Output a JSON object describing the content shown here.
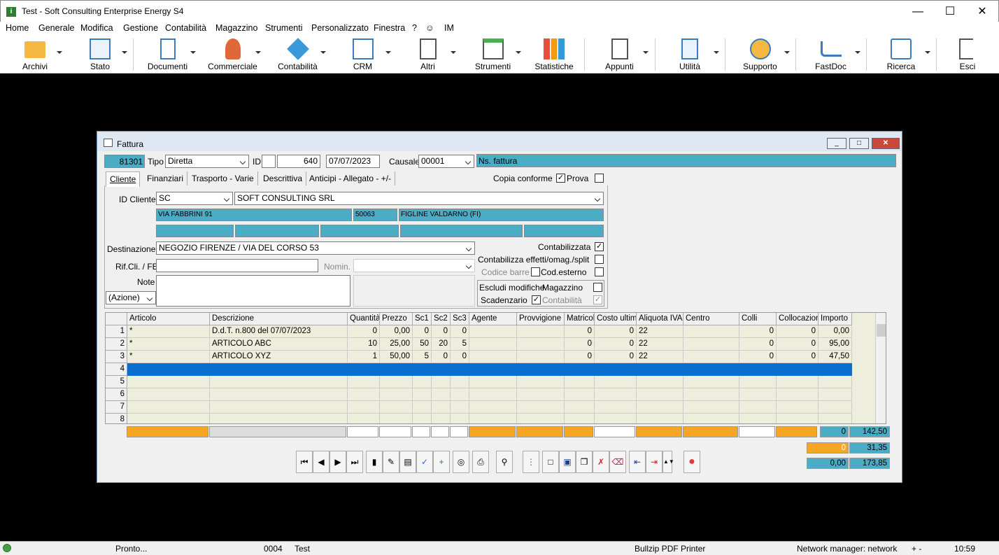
{
  "app": {
    "title": "Test - Soft Consulting Enterprise Energy S4"
  },
  "menu": [
    "Home",
    "Generale",
    "Modifica",
    "Gestione",
    "Contabilità",
    "Magazzino",
    "Strumenti",
    "Personalizzato",
    "Finestra",
    "?",
    "☺",
    "IM"
  ],
  "toolbar": [
    "Archivi",
    "Stato",
    "Documenti",
    "Commerciale",
    "Contabilità",
    "CRM",
    "Altri",
    "Strumenti",
    "Statistiche",
    "Appunti",
    "Utilità",
    "Supporto",
    "FastDoc",
    "Ricerca",
    "Esci"
  ],
  "form": {
    "title": "Fattura",
    "number": "81301",
    "tipo_label": "Tipo",
    "tipo": "Diretta",
    "id_label": "ID",
    "id_value": "640",
    "date": "07/07/2023",
    "causale_label": "Causale",
    "causale": "00001",
    "causale_desc": "Ns. fattura",
    "tabs": [
      "Cliente",
      "Finanziari",
      "Trasporto - Varie",
      "Descrittiva",
      "Anticipi - Allegato - +/-"
    ],
    "copia_conforme": "Copia conforme",
    "prova": "Prova",
    "id_cliente_label": "ID Cliente",
    "id_cliente": "SC",
    "cliente_name": "SOFT CONSULTING SRL",
    "address": "VIA FABBRINI 91",
    "cap": "50063",
    "city": "FIGLINE VALDARNO (FI)",
    "destinazione_label": "Destinazione",
    "destinazione": "NEGOZIO FIRENZE / VIA DEL CORSO 53",
    "rif_label": "Rif.Cli. / FE",
    "nomin_label": "Nomin.",
    "note_label": "Note",
    "azione": "(Azione)",
    "contabilizzata": "Contabilizzata",
    "contabilizza_effetti": "Contabilizza effetti/omag./split",
    "codice_barre": "Codice barre",
    "cod_esterno": "Cod.esterno",
    "escludi": "Escludi modifiche",
    "magazzino": "Magazzino",
    "scadenzario": "Scadenzario",
    "contabilita": "Contabilità"
  },
  "grid": {
    "headers": [
      "Articolo",
      "Descrizione",
      "Quantità",
      "Prezzo",
      "Sc1",
      "Sc2",
      "Sc3",
      "Agente",
      "Provvigione",
      "Matricola",
      "Costo ultimo",
      "Aliquota IVA",
      "Centro",
      "Colli",
      "Collocazione",
      "Importo"
    ],
    "rows": [
      [
        "*",
        "D.d.T. n.800 del 07/07/2023",
        "0",
        "0,00",
        "0",
        "0",
        "0",
        "",
        "",
        "0",
        "0",
        "22",
        "",
        "0",
        "0",
        "0,00"
      ],
      [
        "*",
        "ARTICOLO ABC",
        "10",
        "25,00",
        "50",
        "20",
        "5",
        "",
        "",
        "0",
        "0",
        "22",
        "",
        "0",
        "0",
        "95,00"
      ],
      [
        "*",
        "ARTICOLO XYZ",
        "1",
        "50,00",
        "5",
        "0",
        "0",
        "",
        "",
        "0",
        "0",
        "22",
        "",
        "0",
        "0",
        "47,50"
      ]
    ],
    "row_numbers": [
      "1",
      "2",
      "3",
      "4",
      "5",
      "6",
      "7",
      "8"
    ]
  },
  "totals": {
    "t1": "0",
    "t2": "142,50",
    "t3": "0",
    "t4": "31,35",
    "t5": "0,00",
    "t6": "173,85"
  },
  "status": {
    "text": "Pronto...",
    "code": "0004",
    "user": "Test",
    "printer": "Bullzip PDF Printer",
    "network": "Network manager: network",
    "zoom": "+  -",
    "time": "10:59"
  }
}
